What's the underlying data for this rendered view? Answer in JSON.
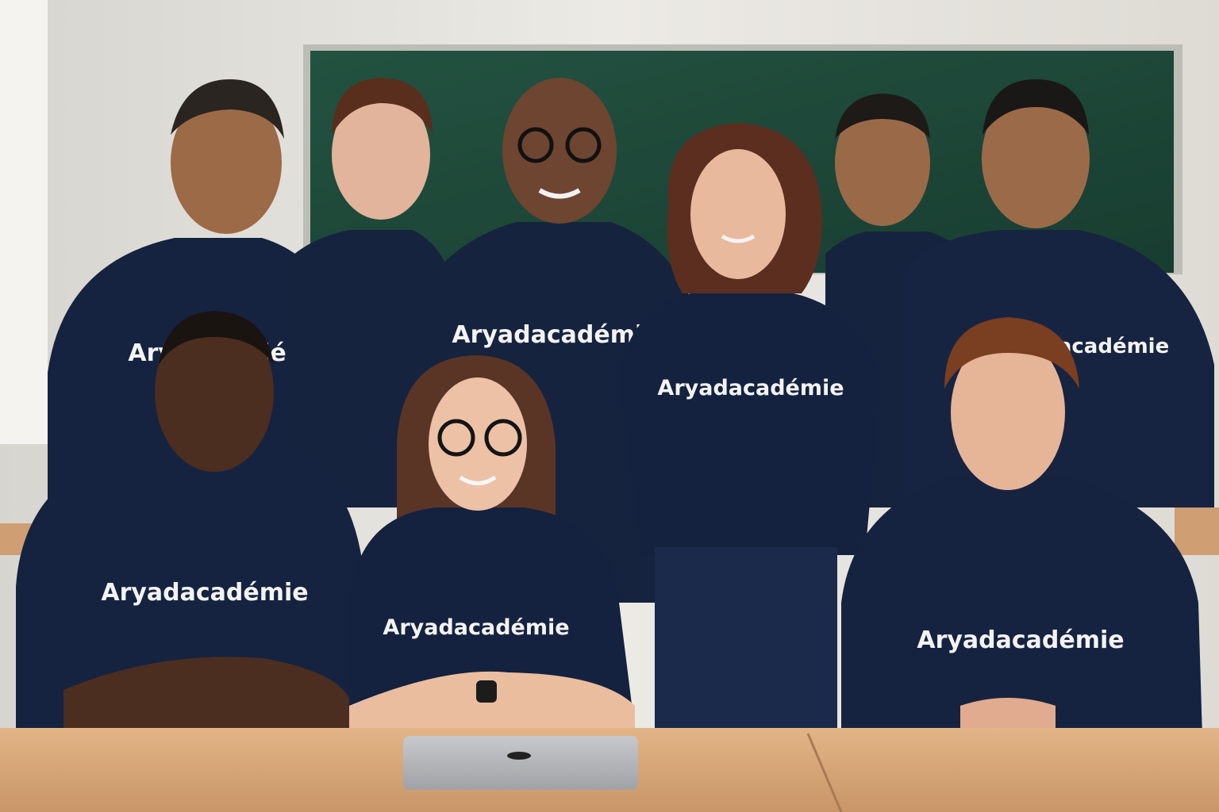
{
  "photo": {
    "shirt_logo_text": "Aryadacadémie",
    "colors": {
      "wall": "#e9e7e2",
      "chalkboard": "#1f4a3a",
      "chalkboard_frame": "#b9b9b5",
      "shirt_navy": "#14213d",
      "desk": "#d9a978",
      "laptop": "#b7b9bc"
    }
  }
}
